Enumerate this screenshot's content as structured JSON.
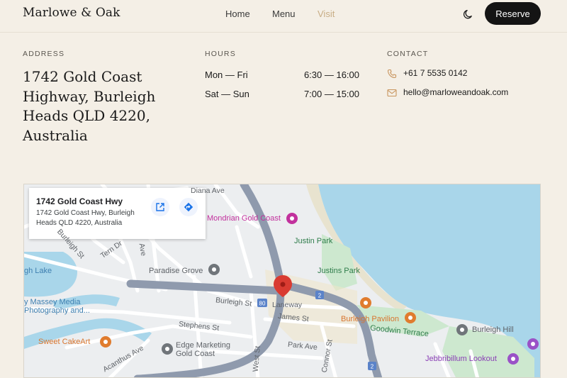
{
  "header": {
    "logo": "Marlowe & Oak",
    "nav": [
      "Home",
      "Menu",
      "Visit"
    ],
    "active_nav": "Visit",
    "reserve_label": "Reserve",
    "theme_icon": "moon-icon"
  },
  "address": {
    "label": "ADDRESS",
    "text": "1742 Gold Coast Highway, Burleigh Heads QLD 4220, Australia"
  },
  "hours": {
    "label": "HOURS",
    "rows": [
      {
        "day": "Mon — Fri",
        "time": "6:30 — 16:00"
      },
      {
        "day": "Sat — Sun",
        "time": "7:00 — 15:00"
      }
    ]
  },
  "contact": {
    "label": "CONTACT",
    "phone": "+61 7 5535 0142",
    "email": "hello@marloweandoak.com",
    "phone_icon": "phone-icon",
    "email_icon": "mail-icon"
  },
  "map": {
    "info_title": "1742 Gold Coast Hwy",
    "info_address": "1742 Gold Coast Hwy, Burleigh Heads QLD 4220, Australia",
    "pois": {
      "mondrian": "Mondrian Gold Coast",
      "justin_park": "Justin Park",
      "justins_park": "Justins Park",
      "paradise_grove": "Paradise Grove",
      "burleigh_pavilion": "Burleigh Pavilion",
      "burleigh_hill": "Burleigh Hill",
      "goodwin_terrace": "Goodwin Terrace",
      "jebbribillum": "Jebbribillum Lookout",
      "edge_marketing": "Edge Marketing Gold Coast",
      "sweet_cakeart": "Sweet CakeArt",
      "massey_media": "y Massey Media Photography and...",
      "lake": "gh Lake"
    },
    "streets": {
      "diana": "Diana Ave",
      "burleigh_st": "Burleigh St",
      "burleigh_st_left": "Burleigh St",
      "tern": "Tern Dr",
      "ave": "Ave",
      "laneway": "Laneway",
      "james": "James St",
      "stephens": "Stephens St",
      "park": "Park Ave",
      "acanthus": "Acanthus Ave",
      "west": "West St",
      "connor": "Connor St"
    },
    "shields": [
      "80",
      "2",
      "2"
    ],
    "colors": {
      "water": "#a9d6ea",
      "park": "#cde8cf",
      "highway": "#8f9aad",
      "marker": "#d93b31"
    }
  }
}
